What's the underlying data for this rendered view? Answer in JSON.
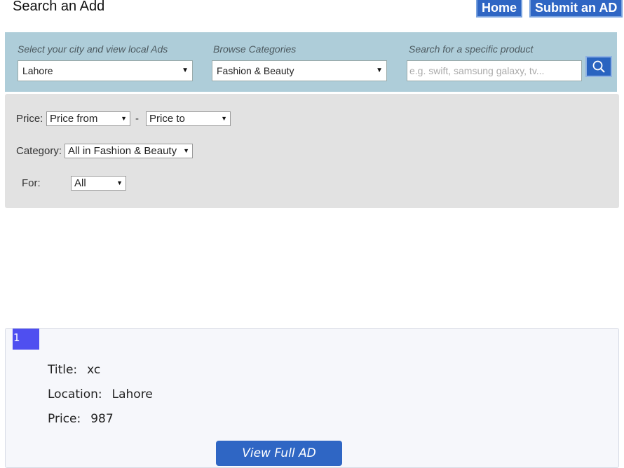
{
  "header": {
    "title": "Search an Add",
    "nav": {
      "home": "Home",
      "submit": "Submit an AD"
    }
  },
  "search_bar": {
    "city_label": "Select your city and view local Ads",
    "city_value": "Lahore",
    "category_label": "Browse Categories",
    "category_value": "Fashion & Beauty",
    "search_label": "Search for a specific product",
    "search_placeholder": "e.g. swift, samsung galaxy, tv...",
    "search_icon": "search-icon"
  },
  "filters": {
    "price_label": "Price:",
    "price_from": "Price from",
    "price_separator": "-",
    "price_to": "Price to",
    "category_label": "Category:",
    "category_value": "All in Fashion & Beauty",
    "for_label": "For:",
    "for_value": "All"
  },
  "ads": [
    {
      "number": "1",
      "title_key": "Title:",
      "title_value": "xc",
      "location_key": "Location:",
      "location_value": "Lahore",
      "price_key": "Price:",
      "price_value": "987",
      "view_button": "View Full AD"
    }
  ],
  "colors": {
    "nav_blue": "#2f66c4",
    "search_bar_bg": "#aecdd9",
    "filters_bg": "#e2e2e2",
    "ad_number_bg": "#4f4ff0"
  }
}
